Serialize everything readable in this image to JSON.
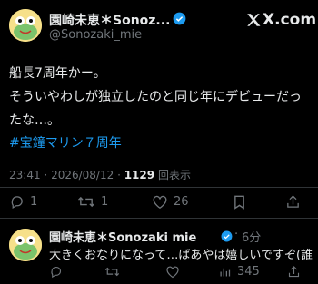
{
  "post": {
    "author_name": "園崎未恵＊Sonoz...",
    "handle": "@Sonozaki_mie",
    "brand": "X.com",
    "lines": [
      "船長7周年かー。",
      "そういやわしが独立したのと同じ年にデビューだっ",
      "たな…。"
    ],
    "hashtag": "#宝鐘マリン７周年",
    "time": "23:41",
    "date": "2026/08/12",
    "views_count": "1129",
    "views_label": "回表示",
    "replies": "1",
    "reposts": "1",
    "likes": "26"
  },
  "reply": {
    "author_name": "園崎未恵＊Sonozaki mie",
    "age": "6分",
    "text": "大きくおなりになって…ばあやは嬉しいですぞ(誰",
    "views": "345"
  },
  "icons": [
    "verified-icon",
    "x-logo-icon",
    "reply-icon",
    "repost-icon",
    "like-icon",
    "views-icon",
    "bookmark-icon",
    "share-icon"
  ],
  "colors": {
    "accent": "#1d9bf0",
    "muted": "#71767b",
    "text": "#e7e9ea",
    "background": "#000000"
  }
}
